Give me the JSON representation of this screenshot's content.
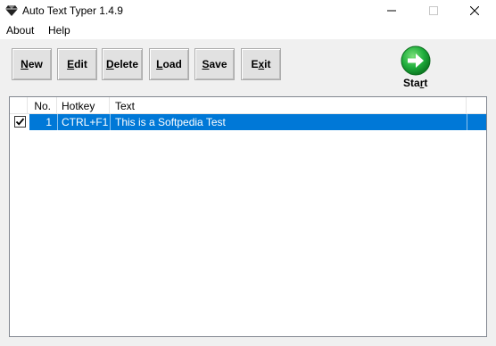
{
  "window": {
    "title": "Auto Text Typer 1.4.9"
  },
  "menu": {
    "items": [
      "About",
      "Help"
    ]
  },
  "toolbar": {
    "new": {
      "pre": "",
      "key": "N",
      "post": "ew"
    },
    "edit": {
      "pre": "",
      "key": "E",
      "post": "dit"
    },
    "delete": {
      "pre": "",
      "key": "D",
      "post": "elete"
    },
    "load": {
      "pre": "",
      "key": "L",
      "post": "oad"
    },
    "save": {
      "pre": "",
      "key": "S",
      "post": "ave"
    },
    "exit": {
      "pre": "E",
      "key": "x",
      "post": "it"
    },
    "start": {
      "pre": "Sta",
      "key": "r",
      "post": "t"
    }
  },
  "list": {
    "columns": [
      "No.",
      "Hotkey",
      "Text"
    ],
    "rows": [
      {
        "checked": true,
        "no": "1",
        "hotkey": "CTRL+F1",
        "text": "This is a Softpedia Test"
      }
    ]
  },
  "colors": {
    "selection": "#0078d7",
    "start_green": "#1fae3c"
  },
  "icons": {
    "app": "diamond-icon",
    "start": "green-arrow-icon"
  }
}
